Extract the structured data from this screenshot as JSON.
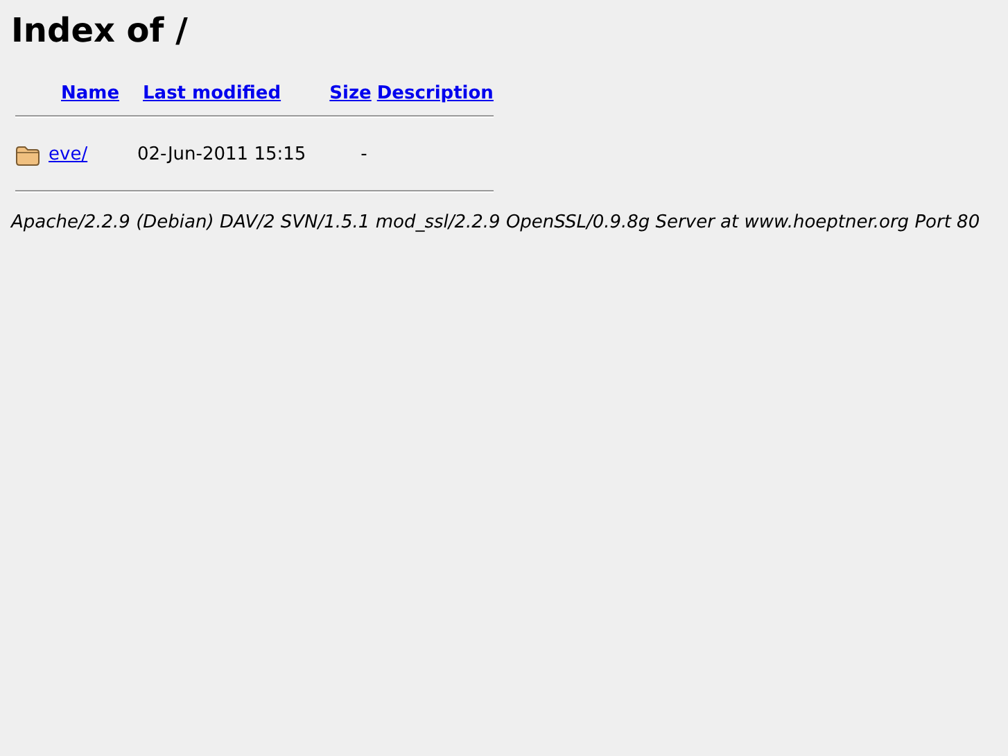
{
  "title": "Index of /",
  "columns": [
    "Name",
    "Last modified",
    "Size",
    "Description"
  ],
  "rows": [
    {
      "kind": "folder",
      "name": "eve/",
      "modified": "02-Jun-2011 15:15",
      "size": "-"
    }
  ],
  "address": "Apache/2.2.9 (Debian) DAV/2 SVN/1.5.1 mod_ssl/2.2.9 OpenSSL/0.9.8g Server at www.hoeptner.org Port 80"
}
